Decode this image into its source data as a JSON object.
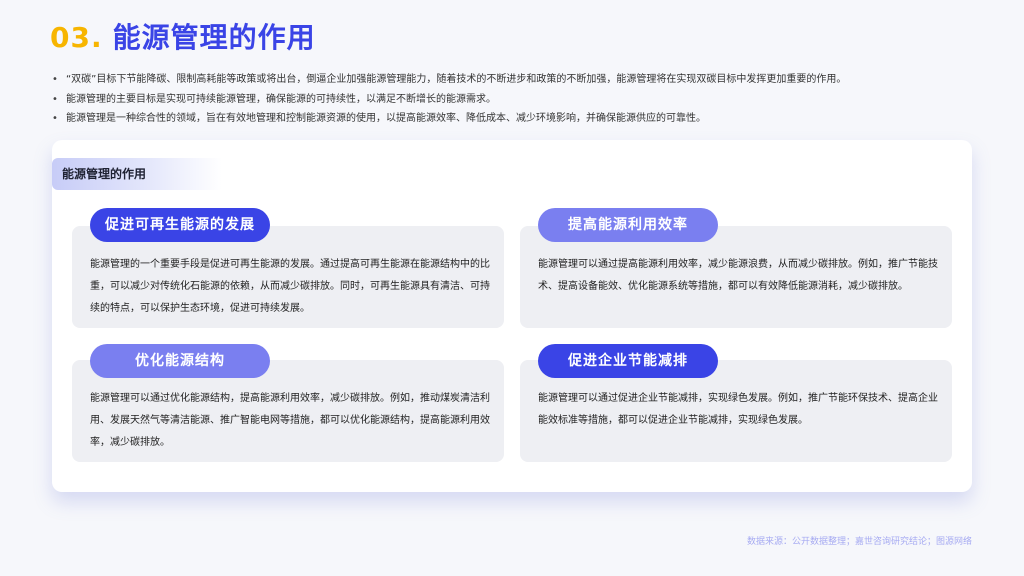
{
  "header": {
    "number": "03.",
    "title": "能源管理的作用"
  },
  "bullets": [
    "“双碳”目标下节能降碳、限制高耗能等政策或将出台，倒逼企业加强能源管理能力，随着技术的不断进步和政策的不断加强，能源管理将在实现双碳目标中发挥更加重要的作用。",
    "能源管理的主要目标是实现可持续能源管理，确保能源的可持续性，以满足不断增长的能源需求。",
    "能源管理是一种综合性的领域，旨在有效地管理和控制能源资源的使用，以提高能源效率、降低成本、减少环境影响，并确保能源供应的可靠性。"
  ],
  "bullet_marker": "•",
  "panel": {
    "tag": "能源管理的作用",
    "cards": [
      {
        "title": "促进可再生能源的发展",
        "body": "能源管理的一个重要手段是促进可再生能源的发展。通过提高可再生能源在能源结构中的比重，可以减少对传统化石能源的依赖，从而减少碳排放。同时，可再生能源具有清洁、可持续的特点，可以保护生态环境，促进可持续发展。"
      },
      {
        "title": "提高能源利用效率",
        "body": "能源管理可以通过提高能源利用效率，减少能源浪费，从而减少碳排放。例如，推广节能技术、提高设备能效、优化能源系统等措施，都可以有效降低能源消耗，减少碳排放。"
      },
      {
        "title": "优化能源结构",
        "body": "能源管理可以通过优化能源结构，提高能源利用效率，减少碳排放。例如，推动煤炭清洁利用、发展天然气等清洁能源、推广智能电网等措施，都可以优化能源结构，提高能源利用效率，减少碳排放。"
      },
      {
        "title": "促进企业节能减排",
        "body": "能源管理可以通过促进企业节能减排，实现绿色发展。例如，推广节能环保技术、提高企业能效标准等措施，都可以促进企业节能减排，实现绿色发展。"
      }
    ]
  },
  "footer": {
    "source": "数据来源：公开数据整理；嘉世咨询研究结论；图源网络"
  },
  "colors": {
    "accent_yellow": "#f7b500",
    "accent_blue": "#3a44e6",
    "pill_light": "#7a7ff0",
    "card_bg": "#eeeff3"
  }
}
